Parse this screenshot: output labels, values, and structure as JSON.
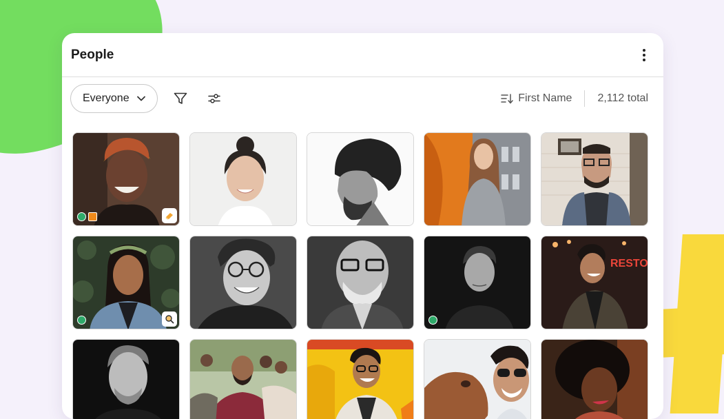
{
  "panel": {
    "title": "People",
    "menu_icon": "kebab-icon"
  },
  "toolbar": {
    "audience_select": {
      "value": "Everyone",
      "icon": "chevron-down-icon"
    },
    "filter_icon": "filter-icon",
    "adjust_icon": "sliders-icon",
    "sort": {
      "label": "First Name",
      "icon": "sort-icon"
    },
    "total_label": "2,112 total"
  },
  "colors": {
    "background": "#f5f1fb",
    "green_blob": "#73dd5f",
    "yellow_blob": "#f9d93c",
    "status_online": "#2faa6a",
    "tag_orange": "#f08a1b"
  },
  "people": [
    {
      "photo": "woman-headwrap",
      "status": "online",
      "tag": "orange",
      "badge": "eraser-icon"
    },
    {
      "photo": "woman-bun"
    },
    {
      "photo": "man-curly-profile"
    },
    {
      "photo": "woman-long-hair-orange"
    },
    {
      "photo": "man-glasses-plaid"
    },
    {
      "photo": "woman-flower-crown",
      "status": "online",
      "badge": "magnifier-icon"
    },
    {
      "photo": "man-round-glasses"
    },
    {
      "photo": "man-bald-glasses"
    },
    {
      "photo": "woman-short-hair",
      "status": "online"
    },
    {
      "photo": "man-laughing-neon"
    },
    {
      "photo": "man-black-portrait"
    },
    {
      "photo": "group-sitting"
    },
    {
      "photo": "man-yellow-background"
    },
    {
      "photo": "man-with-dog"
    },
    {
      "photo": "woman-afro"
    }
  ]
}
